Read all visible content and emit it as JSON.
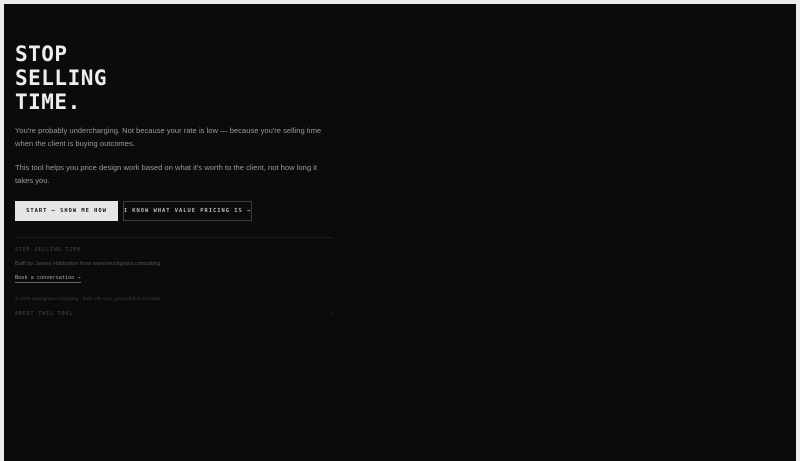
{
  "hero": {
    "title_lines": [
      "STOP",
      "SELLING",
      "TIME."
    ],
    "intro_1": "You're probably undercharging. Not because your rate is low — because you're selling time when the client is buying outcomes.",
    "intro_2": "This tool helps you price design work based on what it's worth to the client, not how long it takes you."
  },
  "actions": {
    "primary_label": "START — SHOW ME HOW",
    "secondary_label": "I KNOW WHAT VALUE PRICING IS →"
  },
  "footer": {
    "brand": "STOP SELLING TIME",
    "credit": "Built by James Haliburton from www.touchgrass.consulting",
    "link_label": "Book a conversation →",
    "copyright": "© 2026 touchgrass.consulting · Built with care, grounded in real data.",
    "about_label": "ABOUT THIS TOOL",
    "about_icon": "›"
  },
  "colors": {
    "background": "#0b0b0b",
    "text_primary": "#ededed",
    "text_muted": "#9a9a9a",
    "button_primary_bg": "#e6e6e6"
  }
}
